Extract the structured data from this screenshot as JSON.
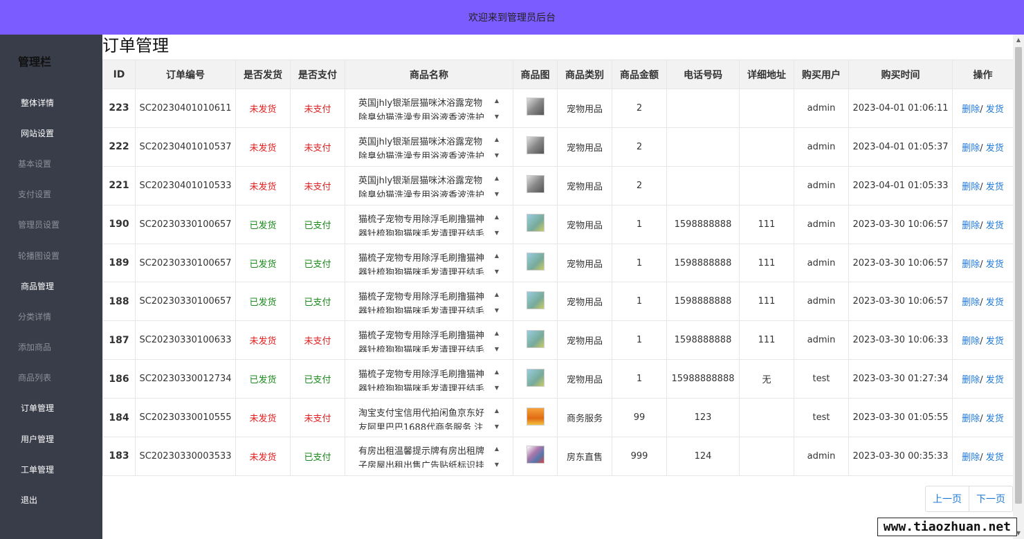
{
  "header": {
    "title": "欢迎来到管理员后台"
  },
  "sidebar": {
    "brand": "管理栏",
    "items": [
      {
        "label": "整体详情",
        "sub": false
      },
      {
        "label": "网站设置",
        "sub": false
      },
      {
        "label": "基本设置",
        "sub": true
      },
      {
        "label": "支付设置",
        "sub": true
      },
      {
        "label": "管理员设置",
        "sub": true
      },
      {
        "label": "轮播图设置",
        "sub": true
      },
      {
        "label": "商品管理",
        "sub": false
      },
      {
        "label": "分类详情",
        "sub": true
      },
      {
        "label": "添加商品",
        "sub": true
      },
      {
        "label": "商品列表",
        "sub": true
      },
      {
        "label": "订单管理",
        "sub": false
      },
      {
        "label": "用户管理",
        "sub": false
      },
      {
        "label": "工单管理",
        "sub": false
      },
      {
        "label": "退出",
        "sub": false
      }
    ]
  },
  "page": {
    "title": "订单管理"
  },
  "table": {
    "headers": [
      "ID",
      "订单编号",
      "是否发货",
      "是否支付",
      "商品名称",
      "商品图",
      "商品类别",
      "商品金额",
      "电话号码",
      "详细地址",
      "购买用户",
      "购买时间",
      "操作"
    ],
    "actions": {
      "delete": "删除",
      "sep": "/ ",
      "ship": "发货"
    },
    "rows": [
      {
        "id": "223",
        "order_no": "SC20230401010611",
        "shipped": "未发货",
        "paid": "未支付",
        "name": "英国jhly银渐层猫咪沐浴露宠物除臭幼猫洗澡专用浴液香波洗护",
        "img": "t1",
        "category": "宠物用品",
        "amount": "2",
        "phone": "",
        "address": "",
        "user": "admin",
        "time": "2023-04-01 01:06:11"
      },
      {
        "id": "222",
        "order_no": "SC20230401010537",
        "shipped": "未发货",
        "paid": "未支付",
        "name": "英国jhly银渐层猫咪沐浴露宠物除臭幼猫洗澡专用浴液香波洗护",
        "img": "t1",
        "category": "宠物用品",
        "amount": "2",
        "phone": "",
        "address": "",
        "user": "admin",
        "time": "2023-04-01 01:05:37"
      },
      {
        "id": "221",
        "order_no": "SC20230401010533",
        "shipped": "未发货",
        "paid": "未支付",
        "name": "英国jhly银渐层猫咪沐浴露宠物除臭幼猫洗澡专用浴液香波洗护",
        "img": "t1",
        "category": "宠物用品",
        "amount": "2",
        "phone": "",
        "address": "",
        "user": "admin",
        "time": "2023-04-01 01:05:33"
      },
      {
        "id": "190",
        "order_no": "SC20230330100657",
        "shipped": "已发货",
        "paid": "已支付",
        "name": "猫梳子宠物专用除浮毛刷撸猫神器针梳狗狗猫咪毛发清理开结毛",
        "img": "t2",
        "category": "宠物用品",
        "amount": "1",
        "phone": "1598888888",
        "address": "111",
        "user": "admin",
        "time": "2023-03-30 10:06:57"
      },
      {
        "id": "189",
        "order_no": "SC20230330100657",
        "shipped": "已发货",
        "paid": "已支付",
        "name": "猫梳子宠物专用除浮毛刷撸猫神器针梳狗狗猫咪毛发清理开结毛",
        "img": "t2",
        "category": "宠物用品",
        "amount": "1",
        "phone": "1598888888",
        "address": "111",
        "user": "admin",
        "time": "2023-03-30 10:06:57"
      },
      {
        "id": "188",
        "order_no": "SC20230330100657",
        "shipped": "已发货",
        "paid": "已支付",
        "name": "猫梳子宠物专用除浮毛刷撸猫神器针梳狗狗猫咪毛发清理开结毛",
        "img": "t2",
        "category": "宠物用品",
        "amount": "1",
        "phone": "1598888888",
        "address": "111",
        "user": "admin",
        "time": "2023-03-30 10:06:57"
      },
      {
        "id": "187",
        "order_no": "SC20230330100633",
        "shipped": "未发货",
        "paid": "未支付",
        "name": "猫梳子宠物专用除浮毛刷撸猫神器针梳狗狗猫咪毛发清理开结毛",
        "img": "t2",
        "category": "宠物用品",
        "amount": "1",
        "phone": "1598888888",
        "address": "111",
        "user": "admin",
        "time": "2023-03-30 10:06:33"
      },
      {
        "id": "186",
        "order_no": "SC20230330012734",
        "shipped": "已发货",
        "paid": "已支付",
        "name": "猫梳子宠物专用除浮毛刷撸猫神器针梳狗狗猫咪毛发清理开结毛",
        "img": "t2",
        "category": "宠物用品",
        "amount": "1",
        "phone": "15988888888",
        "address": "无",
        "user": "test",
        "time": "2023-03-30 01:27:34"
      },
      {
        "id": "184",
        "order_no": "SC20230330010555",
        "shipped": "未发货",
        "paid": "未支付",
        "name": "淘宝支付宝信用代拍闲鱼京东好友阿里巴巴1688代商务服务 注",
        "img": "t3",
        "category": "商务服务",
        "amount": "99",
        "phone": "123",
        "address": "",
        "user": "test",
        "time": "2023-03-30 01:05:55"
      },
      {
        "id": "183",
        "order_no": "SC20230330003533",
        "shipped": "未发货",
        "paid": "已支付",
        "name": "有房出租温馨提示牌有房出租牌子房屋出租出售广告贴纸标识挂",
        "img": "t4",
        "category": "房东直售",
        "amount": "999",
        "phone": "124",
        "address": "",
        "user": "admin",
        "time": "2023-03-30 00:35:33"
      }
    ]
  },
  "pager": {
    "prev": "上一页",
    "next": "下一页"
  },
  "watermark": "www.tiaozhuan.net",
  "colors": {
    "topbar": "#7a5cff",
    "sidebar": "#393d49",
    "link": "#1e78d7",
    "status_bad": "#e02020",
    "status_good": "#1a8a1a"
  }
}
